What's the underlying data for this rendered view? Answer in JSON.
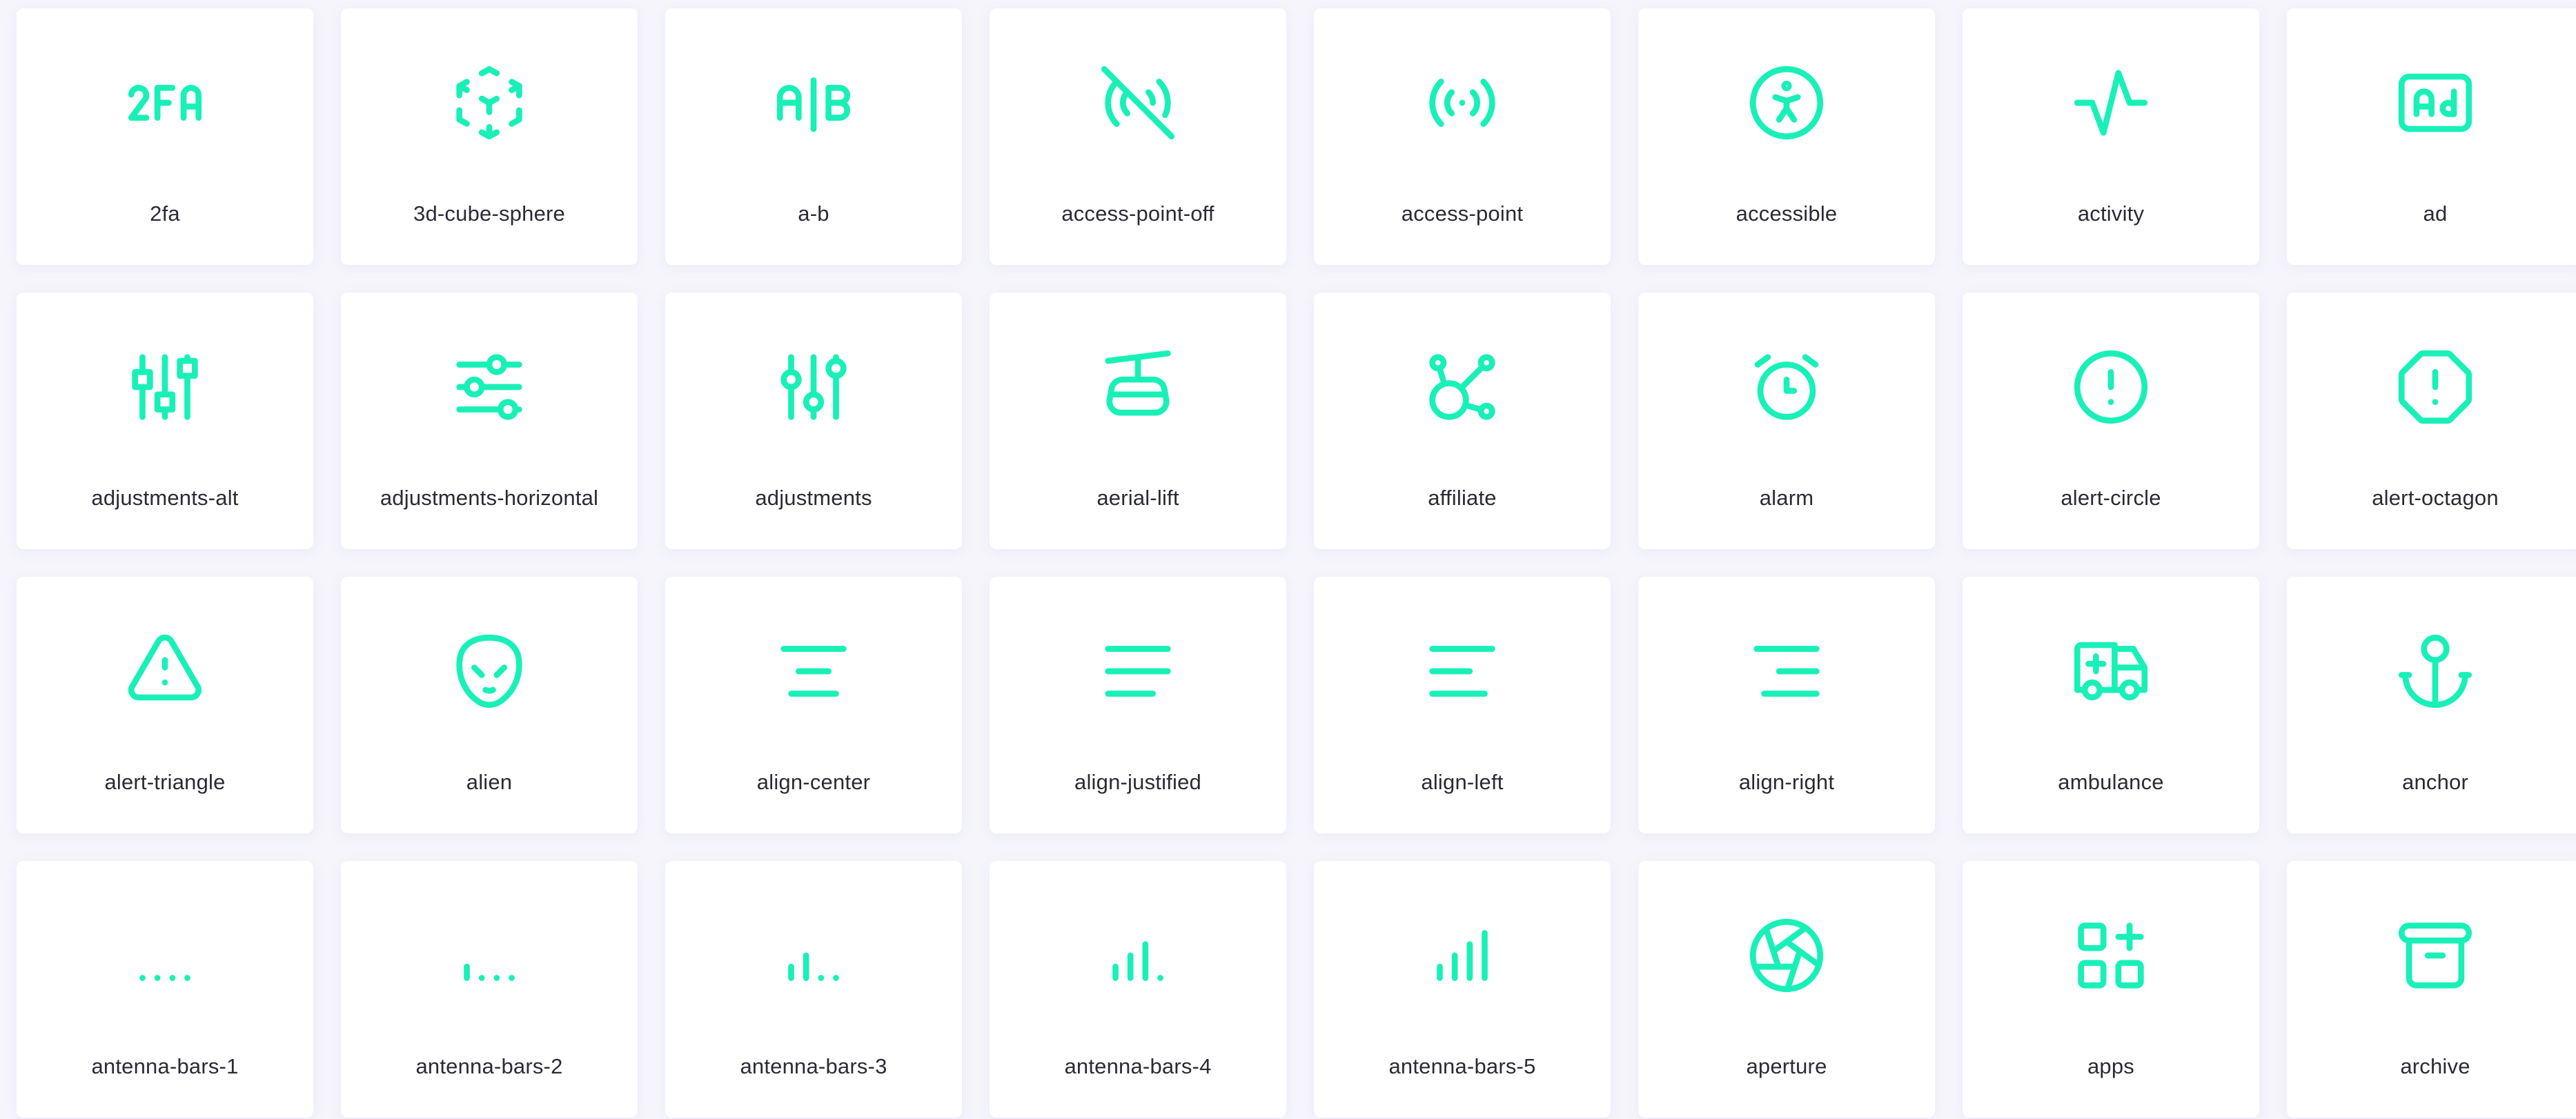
{
  "colors": {
    "accent": "#19f0b8",
    "background": "#f5f5fb",
    "card": "#ffffff",
    "text": "#2b2b36"
  },
  "icons": [
    {
      "label": "2fa",
      "icon": "2fa-icon"
    },
    {
      "label": "3d-cube-sphere",
      "icon": "3d-cube-sphere-icon"
    },
    {
      "label": "a-b",
      "icon": "a-b-icon"
    },
    {
      "label": "access-point-off",
      "icon": "access-point-off-icon"
    },
    {
      "label": "access-point",
      "icon": "access-point-icon"
    },
    {
      "label": "accessible",
      "icon": "accessible-icon"
    },
    {
      "label": "activity",
      "icon": "activity-icon"
    },
    {
      "label": "ad",
      "icon": "ad-icon"
    },
    {
      "label": "adjustments-alt",
      "icon": "adjustments-alt-icon"
    },
    {
      "label": "adjustments-horizontal",
      "icon": "adjustments-horizontal-icon"
    },
    {
      "label": "adjustments",
      "icon": "adjustments-icon"
    },
    {
      "label": "aerial-lift",
      "icon": "aerial-lift-icon"
    },
    {
      "label": "affiliate",
      "icon": "affiliate-icon"
    },
    {
      "label": "alarm",
      "icon": "alarm-icon"
    },
    {
      "label": "alert-circle",
      "icon": "alert-circle-icon"
    },
    {
      "label": "alert-octagon",
      "icon": "alert-octagon-icon"
    },
    {
      "label": "alert-triangle",
      "icon": "alert-triangle-icon"
    },
    {
      "label": "alien",
      "icon": "alien-icon"
    },
    {
      "label": "align-center",
      "icon": "align-center-icon"
    },
    {
      "label": "align-justified",
      "icon": "align-justified-icon"
    },
    {
      "label": "align-left",
      "icon": "align-left-icon"
    },
    {
      "label": "align-right",
      "icon": "align-right-icon"
    },
    {
      "label": "ambulance",
      "icon": "ambulance-icon"
    },
    {
      "label": "anchor",
      "icon": "anchor-icon"
    },
    {
      "label": "antenna-bars-1",
      "icon": "antenna-bars-1-icon"
    },
    {
      "label": "antenna-bars-2",
      "icon": "antenna-bars-2-icon"
    },
    {
      "label": "antenna-bars-3",
      "icon": "antenna-bars-3-icon"
    },
    {
      "label": "antenna-bars-4",
      "icon": "antenna-bars-4-icon"
    },
    {
      "label": "antenna-bars-5",
      "icon": "antenna-bars-5-icon"
    },
    {
      "label": "aperture",
      "icon": "aperture-icon"
    },
    {
      "label": "apps",
      "icon": "apps-icon"
    },
    {
      "label": "archive",
      "icon": "archive-icon"
    }
  ]
}
